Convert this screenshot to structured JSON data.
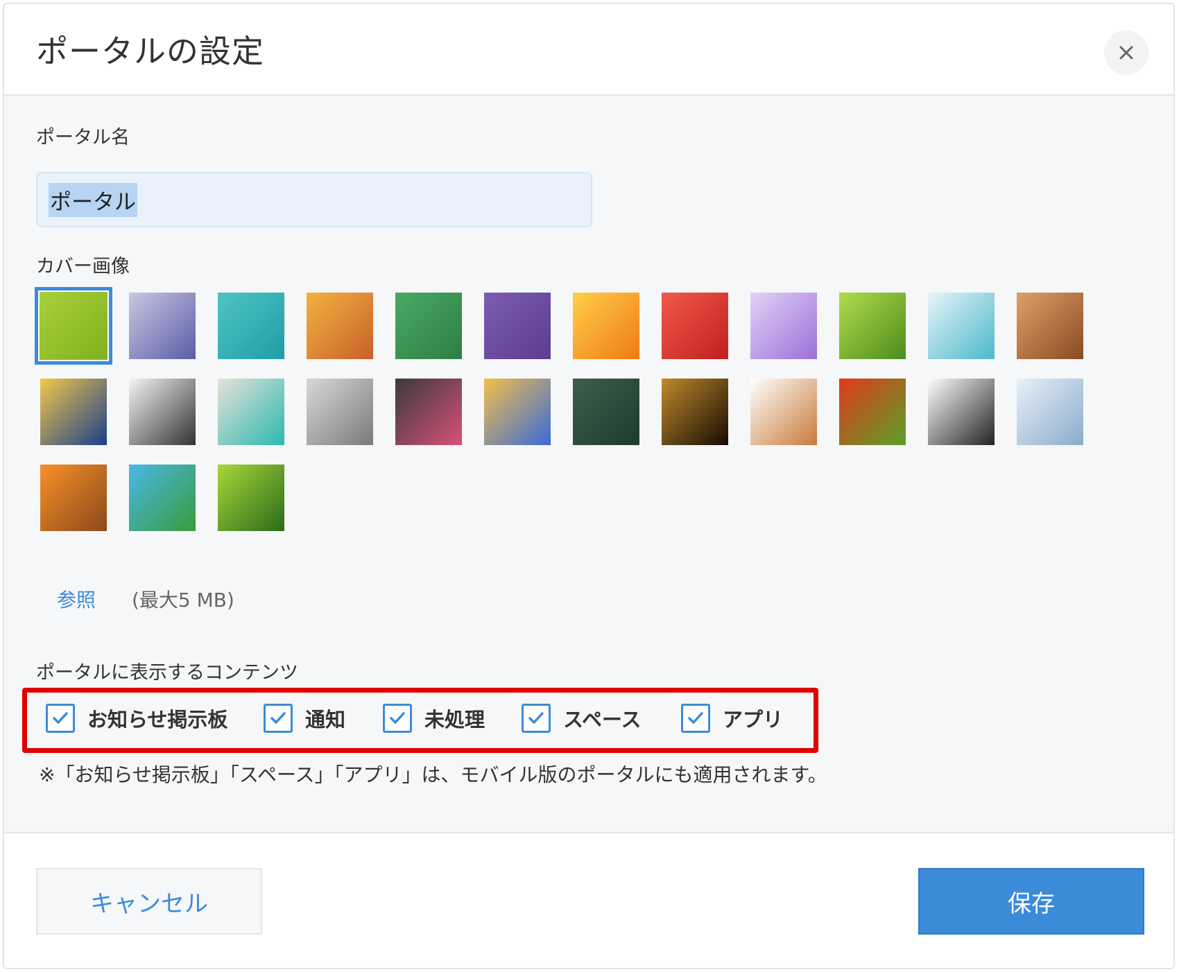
{
  "dialog": {
    "title": "ポータルの設定",
    "close_icon": "close-icon"
  },
  "portal_name": {
    "label": "ポータル名",
    "value": "ポータル"
  },
  "cover": {
    "label": "カバー画像",
    "selected_index": 0,
    "thumbnails": [
      {
        "name": "lime-green",
        "colors": [
          "#a9cf38",
          "#7fb21f"
        ]
      },
      {
        "name": "lavender-gradient",
        "colors": [
          "#c8c8e0",
          "#5a5ca8"
        ]
      },
      {
        "name": "teal-paint",
        "colors": [
          "#4ec4c4",
          "#1f9ea6"
        ]
      },
      {
        "name": "orange-texture",
        "colors": [
          "#f2b240",
          "#c9602a"
        ]
      },
      {
        "name": "green-texture",
        "colors": [
          "#4aa864",
          "#2d7f44"
        ]
      },
      {
        "name": "purple-texture",
        "colors": [
          "#7b5cb0",
          "#5a3e92"
        ]
      },
      {
        "name": "orange-flower",
        "colors": [
          "#ffcf4a",
          "#f07a12"
        ]
      },
      {
        "name": "red-carnation",
        "colors": [
          "#f05a4a",
          "#c01f1f"
        ]
      },
      {
        "name": "purple-hyacinth",
        "colors": [
          "#e2d2f8",
          "#9a70d8"
        ]
      },
      {
        "name": "green-leaf",
        "colors": [
          "#b2dc4a",
          "#4c8c1e"
        ]
      },
      {
        "name": "blue-blocks",
        "colors": [
          "#e8f4f8",
          "#4ab8cc"
        ]
      },
      {
        "name": "woven-wood",
        "colors": [
          "#e0a06a",
          "#8a4a22"
        ]
      },
      {
        "name": "mosaic-tiles",
        "colors": [
          "#f2c84a",
          "#1a3e8a"
        ]
      },
      {
        "name": "compass-map",
        "colors": [
          "#f4f4f4",
          "#333333"
        ]
      },
      {
        "name": "notebooks",
        "colors": [
          "#e8e2d8",
          "#2ab8b0"
        ]
      },
      {
        "name": "gear-blueprint",
        "colors": [
          "#d8d8d8",
          "#7a7a7a"
        ]
      },
      {
        "name": "chalk-doodles",
        "colors": [
          "#3a3a3a",
          "#d8507a"
        ]
      },
      {
        "name": "color-pencils",
        "colors": [
          "#f2c04a",
          "#3a6ad8"
        ]
      },
      {
        "name": "chalkboard-bulb",
        "colors": [
          "#3c5e4a",
          "#1c3c2c"
        ]
      },
      {
        "name": "dark-gradient",
        "colors": [
          "#c08a2a",
          "#160c04"
        ]
      },
      {
        "name": "latte-art",
        "colors": [
          "#ffffff",
          "#c87a3a"
        ]
      },
      {
        "name": "bell-peppers",
        "colors": [
          "#e03a1a",
          "#5aa02a"
        ]
      },
      {
        "name": "cat-and-dog",
        "colors": [
          "#ffffff",
          "#222222"
        ]
      },
      {
        "name": "snowy-trees",
        "colors": [
          "#e8f0f8",
          "#8aaccc"
        ]
      },
      {
        "name": "pumpkins",
        "colors": [
          "#f8902a",
          "#8a4a1a"
        ]
      },
      {
        "name": "palm-beach",
        "colors": [
          "#4ab8e8",
          "#3a9a3a"
        ]
      },
      {
        "name": "bamboo",
        "colors": [
          "#a8d83a",
          "#2a6a1a"
        ]
      }
    ],
    "browse_label": "参照",
    "size_note": "(最大5 MB)"
  },
  "contents": {
    "label": "ポータルに表示するコンテンツ",
    "items": [
      {
        "label": "お知らせ掲示板",
        "checked": true
      },
      {
        "label": "通知",
        "checked": true
      },
      {
        "label": "未処理",
        "checked": true
      },
      {
        "label": "スペース",
        "checked": true
      },
      {
        "label": "アプリ",
        "checked": true
      }
    ],
    "note": "※「お知らせ掲示板」「スペース」「アプリ」は、モバイル版のポータルにも適用されます。"
  },
  "footer": {
    "cancel_label": "キャンセル",
    "save_label": "保存"
  },
  "colors": {
    "accent": "#3c8bd9",
    "highlight": "#e00000"
  }
}
